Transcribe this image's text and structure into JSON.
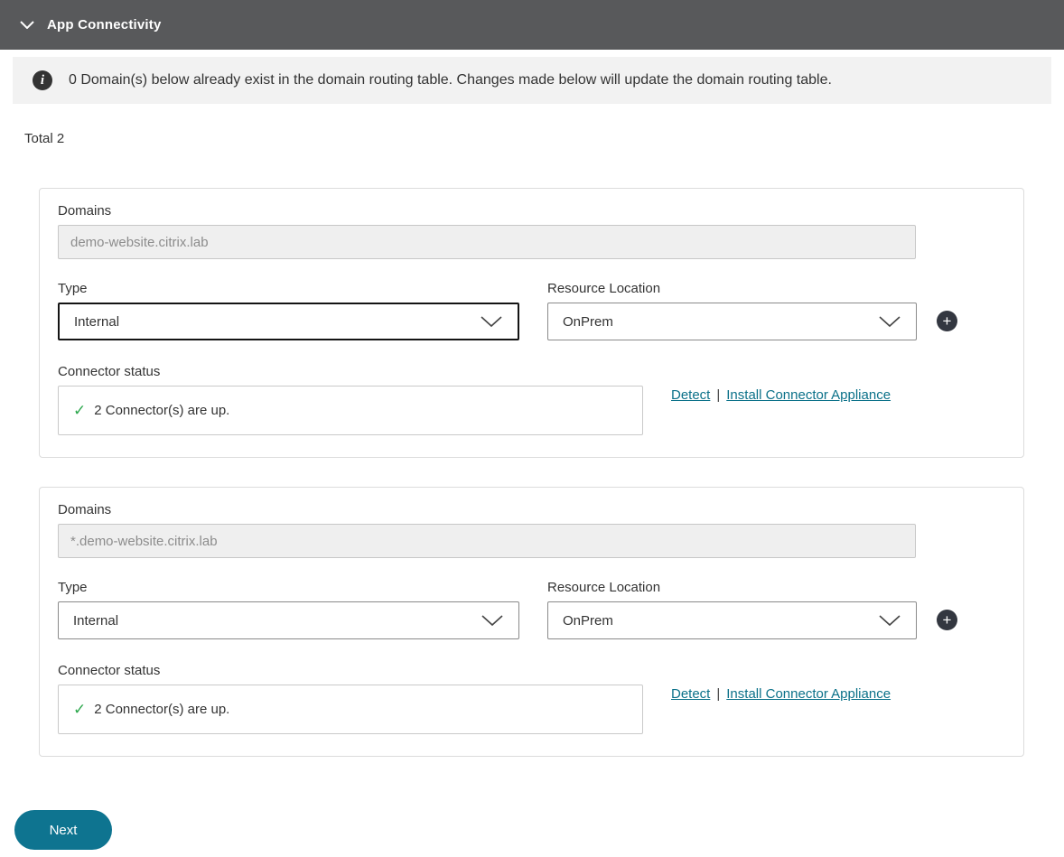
{
  "header": {
    "title": "App Connectivity"
  },
  "banner": {
    "text": "0 Domain(s) below already exist in the domain routing table. Changes made below will update the domain routing table."
  },
  "total": "Total 2",
  "cards": [
    {
      "domains_label": "Domains",
      "domain": "demo-website.citrix.lab",
      "type_label": "Type",
      "type": "Internal",
      "resource_label": "Resource Location",
      "resource": "OnPrem",
      "connector_label": "Connector status",
      "connector_status": "2 Connector(s) are up.",
      "links": {
        "detect": "Detect",
        "sep": "|",
        "install": "Install Connector Appliance"
      }
    },
    {
      "domains_label": "Domains",
      "domain": "*.demo-website.citrix.lab",
      "type_label": "Type",
      "type": "Internal",
      "resource_label": "Resource Location",
      "resource": "OnPrem",
      "connector_label": "Connector status",
      "connector_status": "2 Connector(s) are up.",
      "links": {
        "detect": "Detect",
        "sep": "|",
        "install": "Install Connector Appliance"
      }
    }
  ],
  "footer": {
    "next": "Next"
  },
  "colors": {
    "header_bg": "#58595b",
    "banner_bg": "#f2f2f2",
    "accent": "#0e7490",
    "link": "#0b7189",
    "success": "#2ea84e",
    "plus_bg": "#333740"
  }
}
